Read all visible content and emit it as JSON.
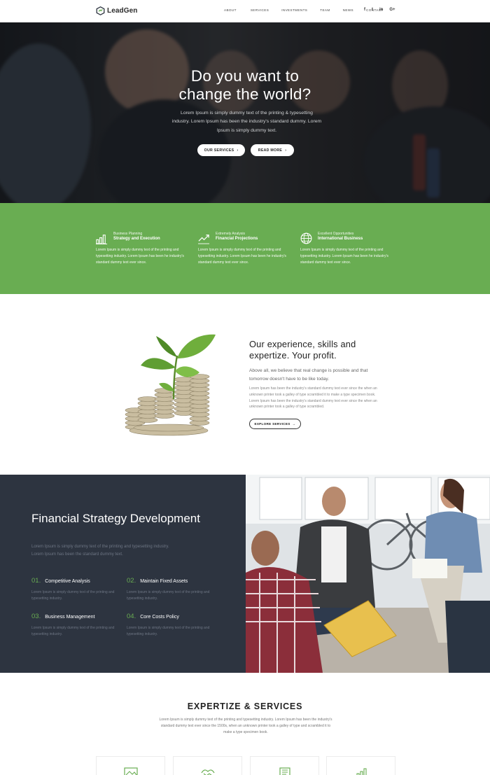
{
  "brand": {
    "name": "LeadGen",
    "accent": "#69ad52",
    "dark": "#2d3440"
  },
  "nav": {
    "items": [
      "ABOUT",
      "SERVICES",
      "INVESTMENTS",
      "TEAM",
      "NEWS",
      "CONTACT"
    ],
    "social": [
      "f",
      "t",
      "in",
      "G+"
    ]
  },
  "hero": {
    "title_line1": "Do you want to",
    "title_line2": "change the world?",
    "subtitle": "Lorem Ipsum is simply dummy text of the printing & typesetting industry. Lorem Ipsum has been the industry's standard dummy. Lorem Ipsum is simply dummy text.",
    "button_services": "OUR SERVICES",
    "button_read": "READ MORE",
    "arrow": "›"
  },
  "features": [
    {
      "icon": "bar-chart-icon",
      "small": "Business Planning",
      "title": "Strategy and Execution",
      "desc": "Lorem Ipsum is simply dummy text of the printing and typesetting industry. Lorem Ipsum has been he industry's standard dummy text ever since."
    },
    {
      "icon": "trend-line-icon",
      "small": "Extremely Analysis",
      "title": "Financial Projections",
      "desc": "Lorem Ipsum is simply dummy text of the printing and typesetting industry. Lorem Ipsum has been he industry's standard dummy text ever since."
    },
    {
      "icon": "globe-icon",
      "small": "Excellent Opportunities",
      "title": "International Business",
      "desc": "Lorem Ipsum is simply dummy text of the printing and typesetting industry. Lorem Ipsum has been he industry's standard dummy text ever since."
    }
  ],
  "experience": {
    "title": "Our experience, skills and expertize. Your profit.",
    "lead": "Above all, we believe that real change is possible and that tomorrow doesn't have to be like today.",
    "body": "Lorem Ipsum has been the industry's standard dummy text ever since the when an unknown printer took a galley of type scrambled it to make a type specimen book. Lorem Ipsum has been the industry's standard dummy text ever since the when an unknown printer took a galley of type scrambled.",
    "button": "EXPLORE SERVICES",
    "arrow": "→"
  },
  "strategy": {
    "title": "Financial Strategy Development",
    "subtitle": "Lorem Ipsum is simply dummy text of the printing and typesetting industry. Lorem Ipsum has been the standard dummy text.",
    "items": [
      {
        "num": "01.",
        "name": "Competitive Analysis",
        "desc": "Lorem Ipsum is simply dummy text of the printing and typesetting industry."
      },
      {
        "num": "02.",
        "name": "Maintain Fixed Assets",
        "desc": "Lorem Ipsum is simply dummy text of the printing and typesetting industry."
      },
      {
        "num": "03.",
        "name": "Business Management",
        "desc": "Lorem Ipsum is simply dummy text of the printing and typesetting industry."
      },
      {
        "num": "04.",
        "name": "Core Costs Policy",
        "desc": "Lorem Ipsum is simply dummy text of the printing and typesetting industry."
      }
    ]
  },
  "expertize": {
    "title": "EXPERTIZE & SERVICES",
    "subtitle": "Lorem Ipsum is simply dummy text of the printing and typesetting industry. Lorem Ipsum has been the industry's standard dummy text ever since the 1500s, when an unknown printer took a galley of type and scrambled it to make a type specimen book.",
    "cards": [
      "image-icon",
      "handshake-icon",
      "document-icon",
      "growth-chart-icon"
    ]
  }
}
